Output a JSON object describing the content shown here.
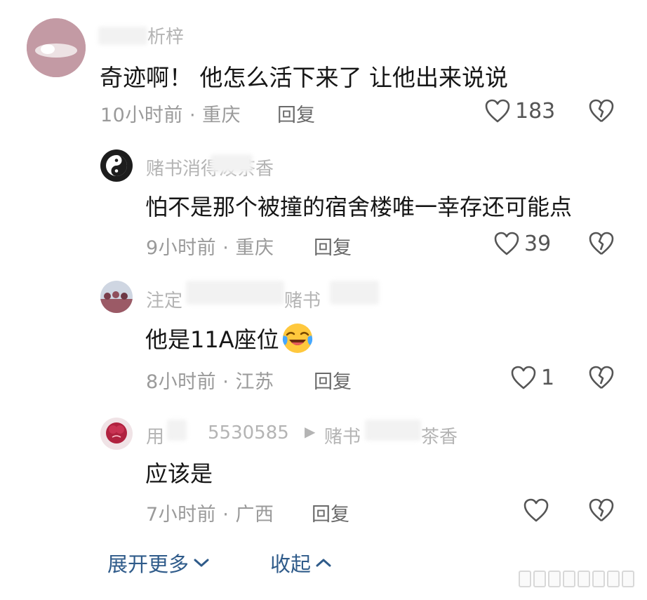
{
  "colors": {
    "text": "#161616",
    "meta": "#9a9a9a",
    "link": "#2f5b8a",
    "name": "#b4b4b4"
  },
  "comments": [
    {
      "username": "析梓",
      "text": "奇迹啊！  他怎么活下来了  让他出来说说",
      "time": "10小时前",
      "location": "重庆",
      "reply_label": "回复",
      "likes": "183",
      "avatar_icon": "pink-blob-avatar"
    },
    {
      "username": "赌书消得泼茶香",
      "text": "怕不是那个被撞的宿舍楼唯一幸存还可能点",
      "time": "9小时前",
      "location": "重庆",
      "reply_label": "回复",
      "likes": "39",
      "avatar_icon": "yin-yang-avatar"
    },
    {
      "username": "注定",
      "reply_to": "赌书",
      "text": "他是11A座位",
      "emoji": "laughing-crying-emoji",
      "time": "8小时前",
      "location": "江苏",
      "reply_label": "回复",
      "likes": "1",
      "avatar_icon": "group-photo-avatar"
    },
    {
      "username": "用",
      "user_id": "5530585",
      "reply_to": "赌书",
      "reply_to_suffix": "茶香",
      "text": "应该是",
      "time": "7小时前",
      "location": "广西",
      "reply_label": "回复",
      "likes": "",
      "avatar_icon": "rose-avatar"
    }
  ],
  "separator": "·",
  "footer": {
    "expand_label": "展开更多",
    "collapse_label": "收起",
    "expand_icon": "chevron-down-icon",
    "collapse_icon": "chevron-up-icon"
  }
}
